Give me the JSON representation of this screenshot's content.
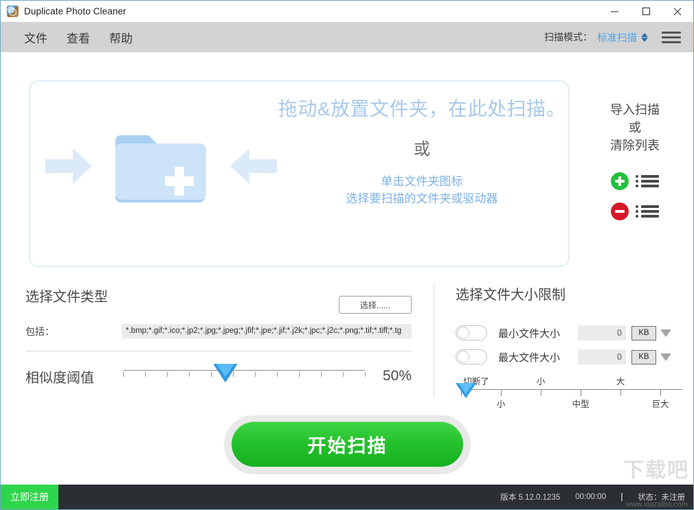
{
  "window": {
    "title": "Duplicate Photo Cleaner",
    "minimize_label": "minimize",
    "maximize_label": "maximize",
    "close_label": "close"
  },
  "menubar": {
    "items": [
      {
        "label": "文件"
      },
      {
        "label": "查看"
      },
      {
        "label": "帮助"
      }
    ],
    "scan_mode_label": "扫描模式：",
    "scan_mode_value": "标准扫描",
    "scan_mode_color": "#4da3e8"
  },
  "dropzone": {
    "title": "拖动&放置文件夹，在此处扫描。",
    "or": "或",
    "sub_line1": "单击文件夹图标",
    "sub_line2": "选择要扫描的文件夹或驱动器",
    "title_color": "#a8c9ea",
    "sub_color": "#7fb2e6",
    "folder_icon": "folder-plus-icon",
    "arrow_left_icon": "arrow-right-icon",
    "arrow_right_icon": "arrow-left-icon"
  },
  "side_panel": {
    "line1": "导入扫描",
    "line2": "或",
    "line3": "清除列表",
    "add_icon": "plus-circle-icon",
    "remove_icon": "minus-circle-icon",
    "list_icon": "list-icon",
    "add_color": "#22c03c",
    "remove_color": "#d4182a"
  },
  "file_types": {
    "title": "选择文件类型",
    "choose_button": "选择......",
    "include_label": "包括：",
    "include_value": "*.bmp;*.gif;*.ico;*.jp2;*.jpg;*.jpeg;*.jfif;*.jpe;*.jif;*.j2k;*.jpc;*.j2c;*.png;*.tif;*.tiff;*.tg"
  },
  "similarity": {
    "label": "相似度阈值",
    "value": "50%",
    "percent": 50
  },
  "file_size": {
    "title": "选择文件大小限制",
    "rows": [
      {
        "label": "最小文件大小",
        "value": "0",
        "unit": "KB",
        "enabled": false
      },
      {
        "label": "最大文件大小",
        "value": "0",
        "unit": "KB",
        "enabled": false
      }
    ],
    "slider": {
      "top_labels": [
        "切断了",
        "小",
        "大"
      ],
      "bottom_labels": [
        "小",
        "中型",
        "巨大"
      ],
      "thumb_position": 0
    }
  },
  "scan": {
    "button_label": "开始扫描",
    "button_color": "#22c02a"
  },
  "statusbar": {
    "register_label": "立即注册",
    "version": "版本 5.12.0.1235",
    "timer": "00:00:00",
    "status": "状态：未注册",
    "register_color": "#2fd54a"
  },
  "watermark": {
    "text": "下载吧",
    "url": "www.xiazaiba.com"
  }
}
